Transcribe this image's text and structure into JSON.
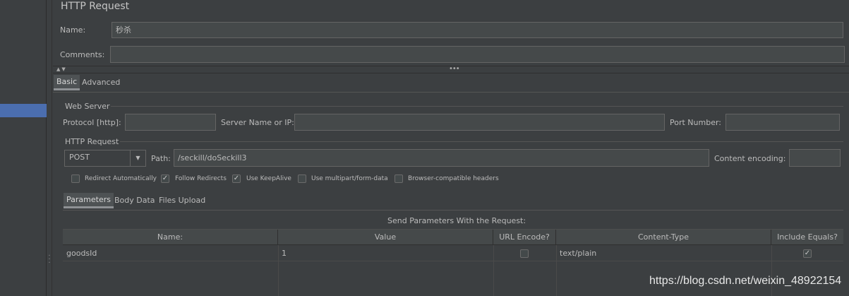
{
  "header": {
    "title": "HTTP Request",
    "name_label": "Name:",
    "name_value": "秒杀",
    "comments_label": "Comments:",
    "comments_value": ""
  },
  "collapse_arrows": "▲▼",
  "top_tabs": [
    {
      "label": "Basic",
      "active": true
    },
    {
      "label": "Advanced",
      "active": false
    }
  ],
  "web_server": {
    "section_label": "Web Server",
    "protocol_label": "Protocol [http]:",
    "protocol_value": "",
    "server_label": "Server Name or IP:",
    "server_value": "",
    "port_label": "Port Number:",
    "port_value": ""
  },
  "http_request": {
    "section_label": "HTTP Request",
    "method": "POST",
    "path_label": "Path:",
    "path_value": "/seckill/doSeckill3",
    "encoding_label": "Content encoding:",
    "encoding_value": ""
  },
  "options": [
    {
      "label": "Redirect Automatically",
      "checked": false
    },
    {
      "label": "Follow Redirects",
      "checked": true
    },
    {
      "label": "Use KeepAlive",
      "checked": true
    },
    {
      "label": "Use multipart/form-data",
      "checked": false
    },
    {
      "label": "Browser-compatible headers",
      "checked": false
    }
  ],
  "param_tabs": [
    {
      "label": "Parameters",
      "active": true
    },
    {
      "label": "Body Data",
      "active": false
    },
    {
      "label": "Files Upload",
      "active": false
    }
  ],
  "params_table": {
    "caption": "Send Parameters With the Request:",
    "columns": [
      "Name:",
      "Value",
      "URL Encode?",
      "Content-Type",
      "Include Equals?"
    ],
    "rows": [
      {
        "name": "goodsId",
        "value": "1",
        "url_encode": false,
        "content_type": "text/plain",
        "include_equals": true
      }
    ]
  },
  "watermark": "https://blog.csdn.net/weixin_48922154",
  "colors": {
    "background": "#3c3f41",
    "field": "#45494a",
    "selection": "#4b6eaf"
  }
}
